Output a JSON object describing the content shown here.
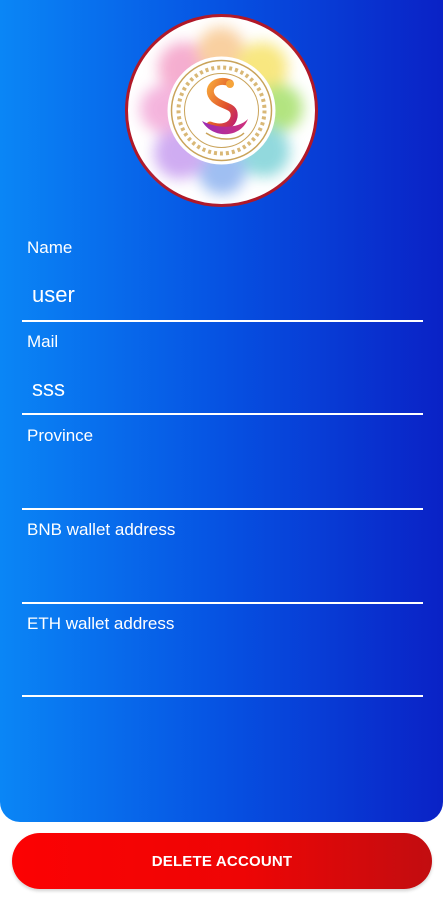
{
  "profile": {
    "avatar_icon": "swan-logo-icon"
  },
  "fields": {
    "name": {
      "label": "Name",
      "value": "user"
    },
    "mail": {
      "label": "Mail",
      "value": "sss"
    },
    "province": {
      "label": "Province",
      "value": ""
    },
    "bnb": {
      "label": "BNB wallet address",
      "value": ""
    },
    "eth": {
      "label": "ETH wallet address",
      "value": ""
    }
  },
  "actions": {
    "delete_label": "DELETE ACCOUNT"
  },
  "colors": {
    "panel_gradient": [
      "#0a86f6",
      "#0652e2",
      "#0a22c6"
    ],
    "button_gradient": [
      "#fc0203",
      "#ee0505",
      "#c20d10"
    ],
    "avatar_ring": "#b01828",
    "text": "#ffffff"
  }
}
